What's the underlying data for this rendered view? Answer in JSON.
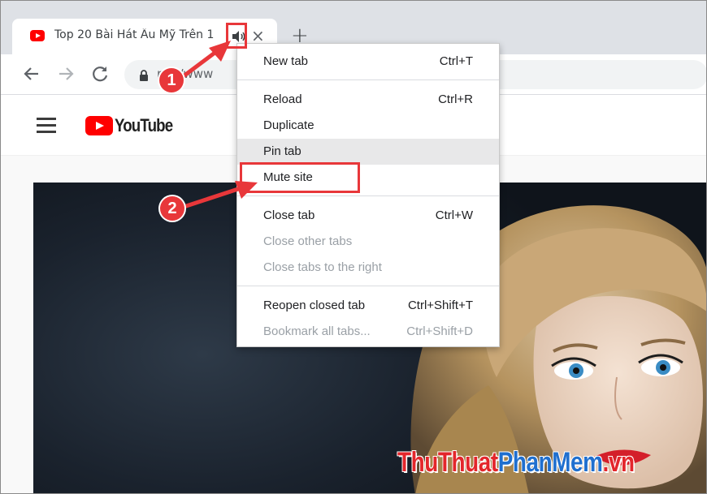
{
  "tab": {
    "title": "Top 20 Bài Hát Âu Mỹ Trên 1",
    "favicon": "youtube-favicon-icon",
    "audio_icon": "speaker-icon",
    "close_symbol": "×",
    "new_tab_symbol": "+"
  },
  "toolbar": {
    "back_icon": "arrow-left-icon",
    "forward_icon": "arrow-right-icon",
    "reload_icon": "reload-icon",
    "lock_icon": "lock-icon",
    "url": "ps://www"
  },
  "youtube": {
    "menu_icon": "hamburger-icon",
    "logo_text": "YouTube"
  },
  "context_menu": {
    "items": [
      {
        "label": "New tab",
        "shortcut": "Ctrl+T",
        "disabled": false
      },
      {
        "label": "Reload",
        "shortcut": "Ctrl+R",
        "disabled": false
      },
      {
        "label": "Duplicate",
        "shortcut": "",
        "disabled": false
      },
      {
        "label": "Pin tab",
        "shortcut": "",
        "disabled": false
      },
      {
        "label": "Mute site",
        "shortcut": "",
        "disabled": false
      },
      {
        "label": "Close tab",
        "shortcut": "Ctrl+W",
        "disabled": false
      },
      {
        "label": "Close other tabs",
        "shortcut": "",
        "disabled": true
      },
      {
        "label": "Close tabs to the right",
        "shortcut": "",
        "disabled": true
      },
      {
        "label": "Reopen closed tab",
        "shortcut": "Ctrl+Shift+T",
        "disabled": false
      },
      {
        "label": "Bookmark all tabs...",
        "shortcut": "Ctrl+Shift+D",
        "disabled": true
      }
    ],
    "hovered": "Pin tab",
    "highlighted": "Mute site"
  },
  "annotations": {
    "step1": "1",
    "step2": "2",
    "color": "#e8373a"
  },
  "watermark": {
    "part1": "ThuThuat",
    "part2": "PhanMem",
    "part3": ".vn"
  },
  "colors": {
    "youtube_red": "#ff0000",
    "tabstrip": "#dee1e6",
    "omnibox": "#f1f3f4"
  }
}
